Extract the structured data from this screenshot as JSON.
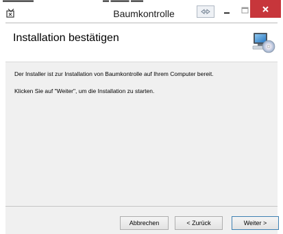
{
  "window": {
    "title": "Baumkontrolle"
  },
  "titlebar_buttons": {
    "extra_icon": "snap-arrows-icon",
    "minimize_icon": "minimize-icon",
    "maximize_icon": "maximize-icon",
    "close_icon": "close-icon",
    "close_color": "#c7363b"
  },
  "header": {
    "title": "Installation bestätigen",
    "icon": "computer-cd-icon"
  },
  "content": {
    "line1": "Der Installer ist zur Installation von Baumkontrolle auf Ihrem Computer bereit.",
    "line2": "Klicken Sie auf \"Weiter\", um die Installation zu starten."
  },
  "footer": {
    "cancel_label": "Abbrechen",
    "back_label": "< Zurück",
    "next_label": "Weiter >"
  }
}
